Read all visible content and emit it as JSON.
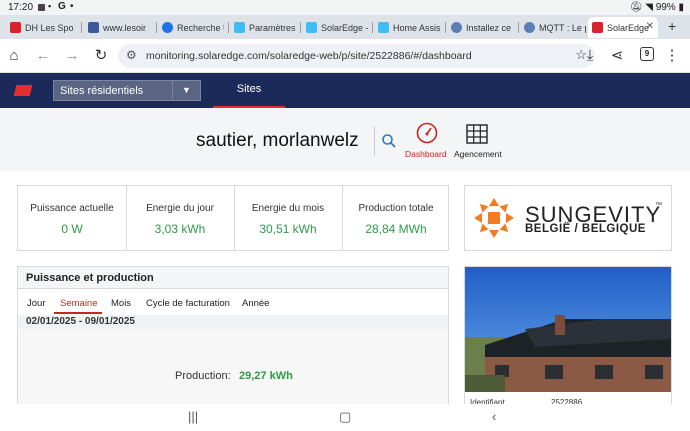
{
  "status_bar": {
    "time": "17:20",
    "battery": "99%"
  },
  "browser": {
    "tabs": [
      {
        "label": "DH Les Spo",
        "color": "#d8232a",
        "icon": "dh-favicon"
      },
      {
        "label": "www.lesoir",
        "color": "#3b5998",
        "icon": "lesoir-favicon"
      },
      {
        "label": "Recherche U",
        "color": "#1a73e8",
        "icon": "search-favicon"
      },
      {
        "label": "Paramètres",
        "color": "#41bdf5",
        "icon": "homeassistant-favicon"
      },
      {
        "label": "SolarEdge -",
        "color": "#41bdf5",
        "icon": "homeassistant-favicon"
      },
      {
        "label": "Home Assis",
        "color": "#41bdf5",
        "icon": "homeassistant-favicon"
      },
      {
        "label": "Installez ce",
        "color": "#5b7fb5",
        "icon": "site-favicon"
      },
      {
        "label": "MQTT : Le p",
        "color": "#5b7fb5",
        "icon": "site-favicon"
      },
      {
        "label": "SolarEdge",
        "color": "#d8232a",
        "icon": "solaredge-favicon"
      }
    ],
    "url": "monitoring.solaredge.com/solaredge-web/p/site/2522886/#/dashboard",
    "tab_count": "9"
  },
  "nav": {
    "site_selector": "Sites résidentiels",
    "sites_tab": "Sites"
  },
  "header": {
    "site_name": "sautier, morlanwelz",
    "dashboard_label": "Dashboard",
    "layout_label": "Agencement"
  },
  "kpis": [
    {
      "title": "Puissance actuelle",
      "value": "0 W"
    },
    {
      "title": "Energie du jour",
      "value": "3,03 kWh"
    },
    {
      "title": "Energie du mois",
      "value": "30,51 kWh"
    },
    {
      "title": "Production totale",
      "value": "28,84 MWh"
    }
  ],
  "brand": {
    "name": "SUNGEVITY",
    "subtitle": "BELGIË / BELGIQUE",
    "tm": "™"
  },
  "panel": {
    "title": "Puissance et production",
    "tabs": [
      "Jour",
      "Semaine",
      "Mois",
      "Cycle de facturation",
      "Année"
    ],
    "selected_tab": "Semaine",
    "date_range": "02/01/2025 - 09/01/2025",
    "production_label": "Production:",
    "production_value": "29,27 kWh"
  },
  "site_info": {
    "id_label": "Identifiant",
    "id_value": "2522886"
  },
  "colors": {
    "nav_bg": "#1c2a59",
    "accent_red": "#c4281c",
    "value_green": "#2f9a4a",
    "brand_orange": "#f47c20"
  }
}
